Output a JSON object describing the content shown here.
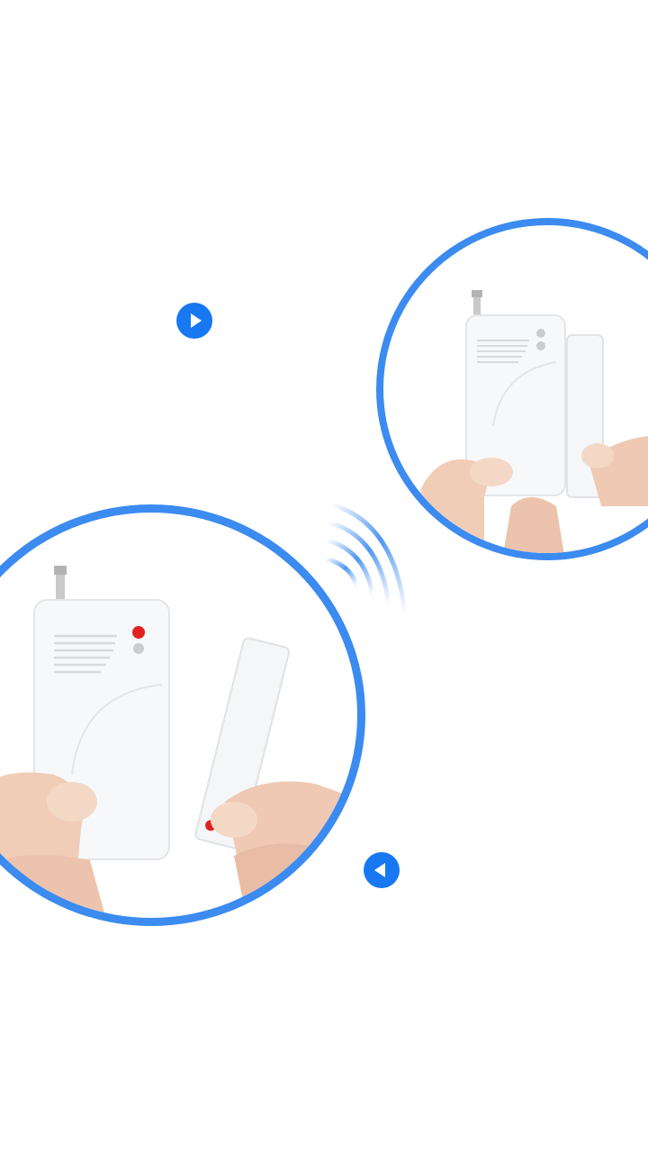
{
  "colors": {
    "ring": "#3b8bf0",
    "nav_button": "#1778f2",
    "device": "#f7f8fa",
    "skin": "#f3d2bf",
    "led_red": "#e22222"
  },
  "icons": {
    "next": "play-right-icon",
    "previous": "play-left-icon",
    "signal": "wireless-signal-icon"
  }
}
